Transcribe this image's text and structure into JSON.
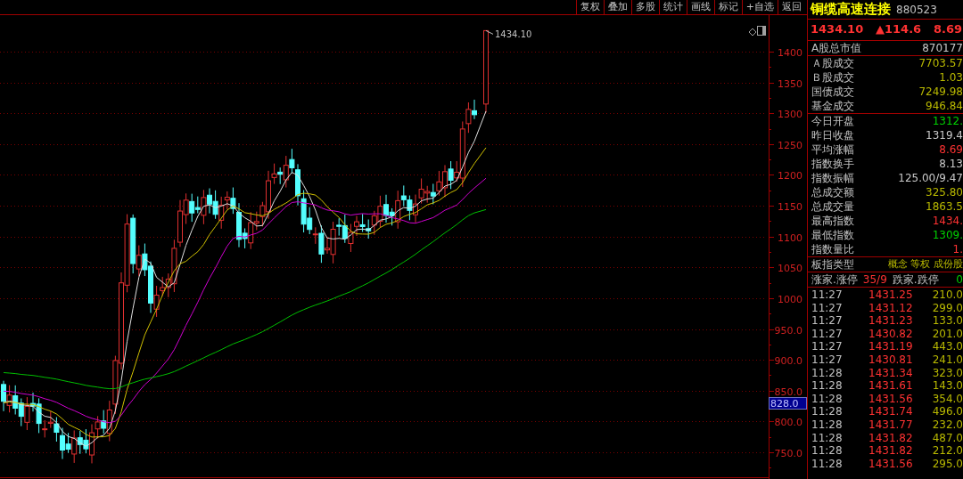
{
  "toolbar": [
    "复权",
    "叠加",
    "多股",
    "统计",
    "画线",
    "标记",
    "+自选",
    "返回"
  ],
  "chart": {
    "y_labels": [
      "1400",
      "1350",
      "1300",
      "1250",
      "1200",
      "1150",
      "1100",
      "1050",
      "1000",
      "950.0",
      "900.0",
      "850.0",
      "800.0",
      "750.0"
    ],
    "high_label": "1434.10",
    "price_marker": "828.0"
  },
  "quote": {
    "name": "铜缆高速连接",
    "code": "880523",
    "price": "1434.10",
    "change": "▲114.6",
    "change_pct": "8.69"
  },
  "stat_groups": [
    [
      {
        "label": "A股总市值",
        "value": "870177",
        "color": "#c8c8c8"
      }
    ],
    [
      {
        "label": "Ａ股成交",
        "value": "7703.57",
        "color": "#b8b800"
      },
      {
        "label": "Ｂ股成交",
        "value": "1.03",
        "color": "#b8b800"
      },
      {
        "label": "国债成交",
        "value": "7249.98",
        "color": "#b8b800"
      },
      {
        "label": "基金成交",
        "value": "946.84",
        "color": "#b8b800"
      }
    ],
    [
      {
        "label": "今日开盘",
        "value": "1312.",
        "color": "#00d000"
      },
      {
        "label": "昨日收盘",
        "value": "1319.4",
        "color": "#c8c8c8"
      },
      {
        "label": "平均涨幅",
        "value": "8.69",
        "color": "#ff3232"
      },
      {
        "label": "指数换手",
        "value": "8.13",
        "color": "#c8c8c8"
      },
      {
        "label": "指数振幅",
        "value": "125.00/9.47",
        "color": "#c8c8c8"
      },
      {
        "label": "总成交额",
        "value": "325.80",
        "color": "#b8b800"
      },
      {
        "label": "总成交量",
        "value": "1863.5",
        "color": "#b8b800"
      },
      {
        "label": "最高指数",
        "value": "1434.",
        "color": "#ff3232"
      },
      {
        "label": "最低指数",
        "value": "1309.",
        "color": "#00d000"
      },
      {
        "label": "指数量比",
        "value": "1.",
        "color": "#ff3232"
      }
    ]
  ],
  "index_type": {
    "label": "板指类型",
    "value": "概念 等权 成份股"
  },
  "breadth": {
    "up_label": "涨家.涨停",
    "up_value": "35/9",
    "down_label": "跌家.跌停",
    "down_value": "0"
  },
  "ticks": [
    {
      "time": "11:27",
      "price": "1431.25",
      "volume": "210.0"
    },
    {
      "time": "11:27",
      "price": "1431.12",
      "volume": "299.0"
    },
    {
      "time": "11:27",
      "price": "1431.23",
      "volume": "133.0"
    },
    {
      "time": "11:27",
      "price": "1430.82",
      "volume": "201.0"
    },
    {
      "time": "11:27",
      "price": "1431.19",
      "volume": "443.0"
    },
    {
      "time": "11:27",
      "price": "1430.81",
      "volume": "241.0"
    },
    {
      "time": "11:28",
      "price": "1431.34",
      "volume": "323.0"
    },
    {
      "time": "11:28",
      "price": "1431.61",
      "volume": "143.0"
    },
    {
      "time": "11:28",
      "price": "1431.56",
      "volume": "354.0"
    },
    {
      "time": "11:28",
      "price": "1431.74",
      "volume": "496.0"
    },
    {
      "time": "11:28",
      "price": "1431.77",
      "volume": "232.0"
    },
    {
      "time": "11:28",
      "price": "1431.82",
      "volume": "487.0"
    },
    {
      "time": "11:28",
      "price": "1431.82",
      "volume": "212.0"
    },
    {
      "time": "11:28",
      "price": "1431.56",
      "volume": "295.0"
    }
  ]
}
